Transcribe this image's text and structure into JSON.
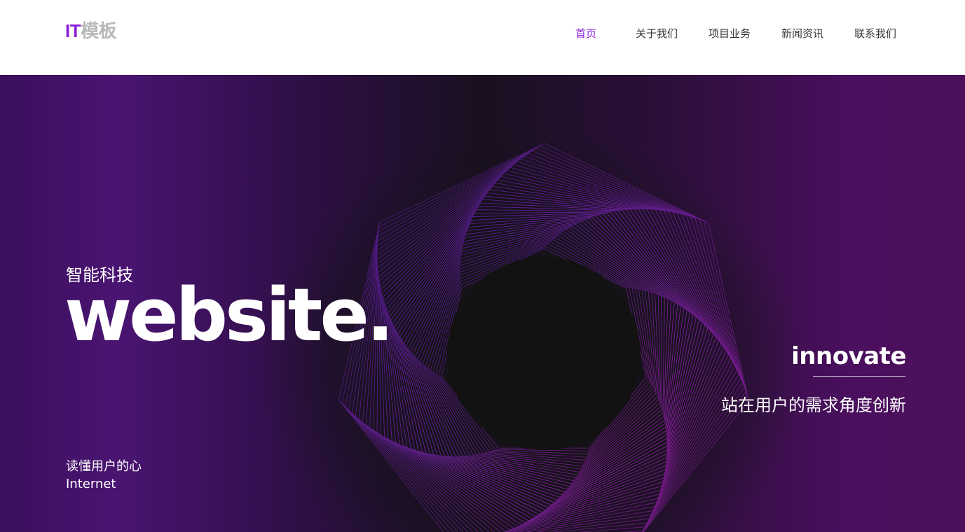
{
  "header": {
    "logo": {
      "part1": "IT",
      "part2": "模板"
    },
    "nav": [
      {
        "label": "首页",
        "active": true
      },
      {
        "label": "关于我们",
        "active": false
      },
      {
        "label": "项目业务",
        "active": false
      },
      {
        "label": "新闻资讯",
        "active": false
      },
      {
        "label": "联系我们",
        "active": false
      }
    ]
  },
  "hero": {
    "subtitle": "智能科技",
    "title": "website.",
    "tag": "innovate",
    "slogan": "站在用户的需求角度创新",
    "bottom_cn": "读懂用户的心",
    "bottom_en": "Internet"
  },
  "colors": {
    "accent": "#8a1fd8",
    "logo_secondary": "#b8b8b8",
    "nav_text": "#333333",
    "hero_purple": "#4a1472"
  }
}
